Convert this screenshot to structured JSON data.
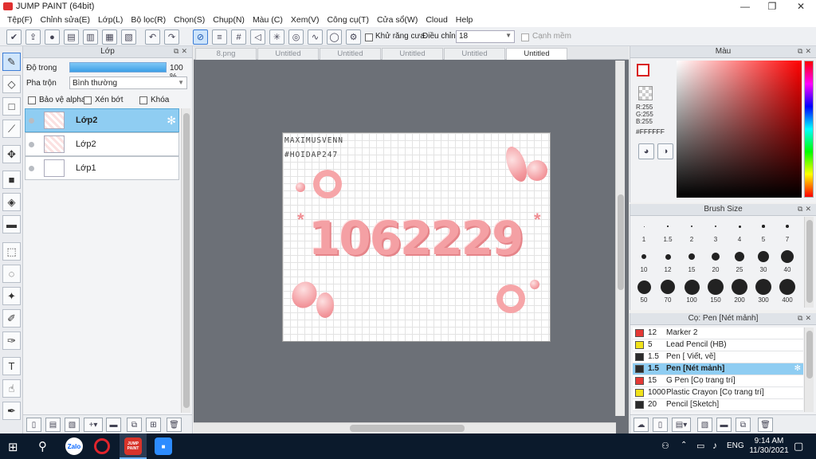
{
  "window": {
    "title": "JUMP PAINT (64bit)"
  },
  "menu": [
    "Tệp(F)",
    "Chỉnh sửa(E)",
    "Lớp(L)",
    "Bộ lọc(R)",
    "Chọn(S)",
    "Chụp(N)",
    "Màu (C)",
    "Xem(V)",
    "Công cụ(T)",
    "Cửa sổ(W)",
    "Cloud",
    "Help"
  ],
  "toolbar": {
    "antialias_label": "Khử răng cưa",
    "adjust_label": "Điều chỉnh",
    "adjust_value": "18",
    "smooth_label": "Cạnh mềm"
  },
  "layer_panel": {
    "title": "Lớp",
    "opacity_label": "Độ trong",
    "opacity_value": "100 %",
    "blend_label": "Pha trộn",
    "blend_value": "Bình thường",
    "protect_alpha": "Bảo vệ alpha",
    "clip": "Xén bớt",
    "lock": "Khóa",
    "layers": [
      {
        "name": "Lớp2",
        "selected": true
      },
      {
        "name": "Lớp2",
        "selected": false
      },
      {
        "name": "Lớp1",
        "selected": false
      }
    ]
  },
  "tabs": [
    "8.png",
    "Untitled",
    "Untitled",
    "Untitled",
    "Untitled",
    "Untitled"
  ],
  "artwork": {
    "line1": "MAXIMUSVENN",
    "line2": "#HOIDAP247",
    "number": "1062229",
    "star": "*"
  },
  "color_panel": {
    "title": "Màu",
    "r": "R:255",
    "g": "G:255",
    "b": "B:255",
    "hex": "#FFFFFF"
  },
  "brush_panel": {
    "title": "Brush Size",
    "sizes": [
      "1",
      "1.5",
      "2",
      "3",
      "4",
      "5",
      "7",
      "10",
      "12",
      "15",
      "20",
      "25",
      "30",
      "40",
      "50",
      "70",
      "100",
      "150",
      "200",
      "300",
      "400"
    ]
  },
  "pen_panel": {
    "title": "Cọ: Pen [Nét mảnh]",
    "items": [
      {
        "size": "12",
        "name": "Marker 2",
        "color": "#e53935"
      },
      {
        "size": "5",
        "name": "Lead Pencil (HB)",
        "color": "#f1e21a"
      },
      {
        "size": "1.5",
        "name": "Pen [ Viết, vẽ]",
        "color": "#2b2b2b"
      },
      {
        "size": "1.5",
        "name": "Pen [Nét mảnh]",
        "color": "#2b2b2b"
      },
      {
        "size": "15",
        "name": "G Pen [Cọ trang trí]",
        "color": "#e53935"
      },
      {
        "size": "1000",
        "name": "Plastic Crayon [Cọ trang trí]",
        "color": "#f1e21a"
      },
      {
        "size": "20",
        "name": "Pencil [Sketch]",
        "color": "#2b2b2b"
      }
    ]
  },
  "taskbar": {
    "lang": "ENG",
    "time": "9:14 AM",
    "date": "11/30/2021",
    "zalo": "Zalo",
    "jump": "JUMP PAINT"
  }
}
